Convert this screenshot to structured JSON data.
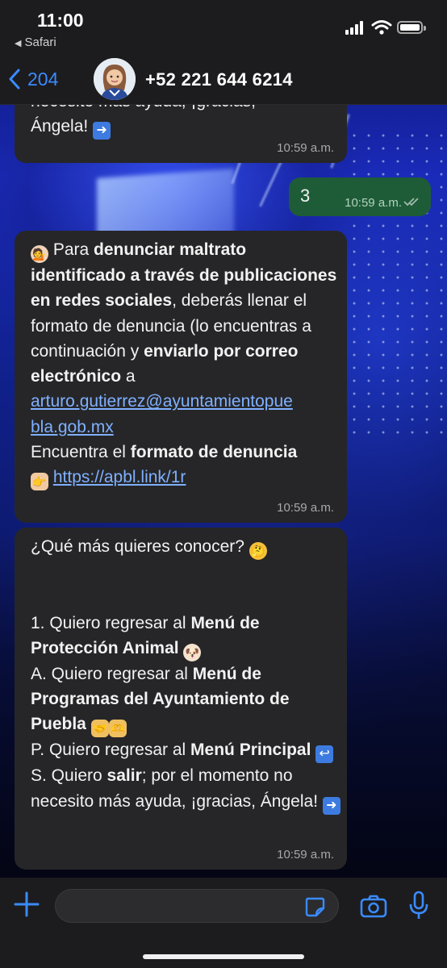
{
  "status_bar": {
    "time": "11:00",
    "back_app": "Safari",
    "icons": [
      "signal-icon",
      "wifi-icon",
      "battery-icon"
    ]
  },
  "header": {
    "back_count": "204",
    "contact": "+52 221 644 6214"
  },
  "messages": {
    "m1": {
      "line1": "necesito más ayuda, ¡gracias,",
      "line2": "Ángela!",
      "time": "10:59 a.m."
    },
    "m2": {
      "text": "3",
      "time": "10:59 a.m."
    },
    "m3": {
      "p1_plain": "Para ",
      "p1_bold": "denunciar maltrato identificado a través de publicaciones en redes sociales",
      "p2_plain": ", deberás llenar el formato de denuncia (lo encuentras a continuación y ",
      "p2_bold": "enviarlo por correo electrónico",
      "p2_end": " a",
      "email_a": "arturo.gutierrez@ayuntamientopue",
      "email_b": "bla.gob.mx",
      "p3_plain": "Encuentra el ",
      "p3_bold": "formato de denuncia",
      "link": "https://apbl.link/1r",
      "time": "10:59 a.m."
    },
    "m4": {
      "question": "¿Qué más quieres conocer?",
      "o1_plain": "1. Quiero regresar al ",
      "o1_bold": "Menú de Protección Animal",
      "oa_plain": "A. Quiero regresar al ",
      "oa_bold": "Menú de Programas del Ayuntamiento de Puebla",
      "op_plain": "P. Quiero regresar al ",
      "op_bold": "Menú Principal",
      "os_plain": "S. Quiero ",
      "os_bold": "salir",
      "os_end": "; por el momento no necesito más ayuda, ¡gracias, Ángela!",
      "time": "10:59 a.m."
    }
  },
  "emoji_icons": [
    "arrow-right-icon",
    "person-tipping-hand-icon",
    "pointing-hand-icon",
    "thinking-face-icon",
    "puppy-icon",
    "handshake-icon",
    "heart-hands-icon",
    "return-arrow-icon"
  ],
  "input_bar": {
    "placeholder": "",
    "icons": [
      "plus-icon",
      "sticker-icon",
      "camera-icon",
      "microphone-icon"
    ]
  },
  "colors": {
    "accent": "#3a8bff",
    "incoming_bubble": "#262628",
    "outgoing_bubble": "#1e5c38",
    "bar": "#1c1c1e"
  }
}
